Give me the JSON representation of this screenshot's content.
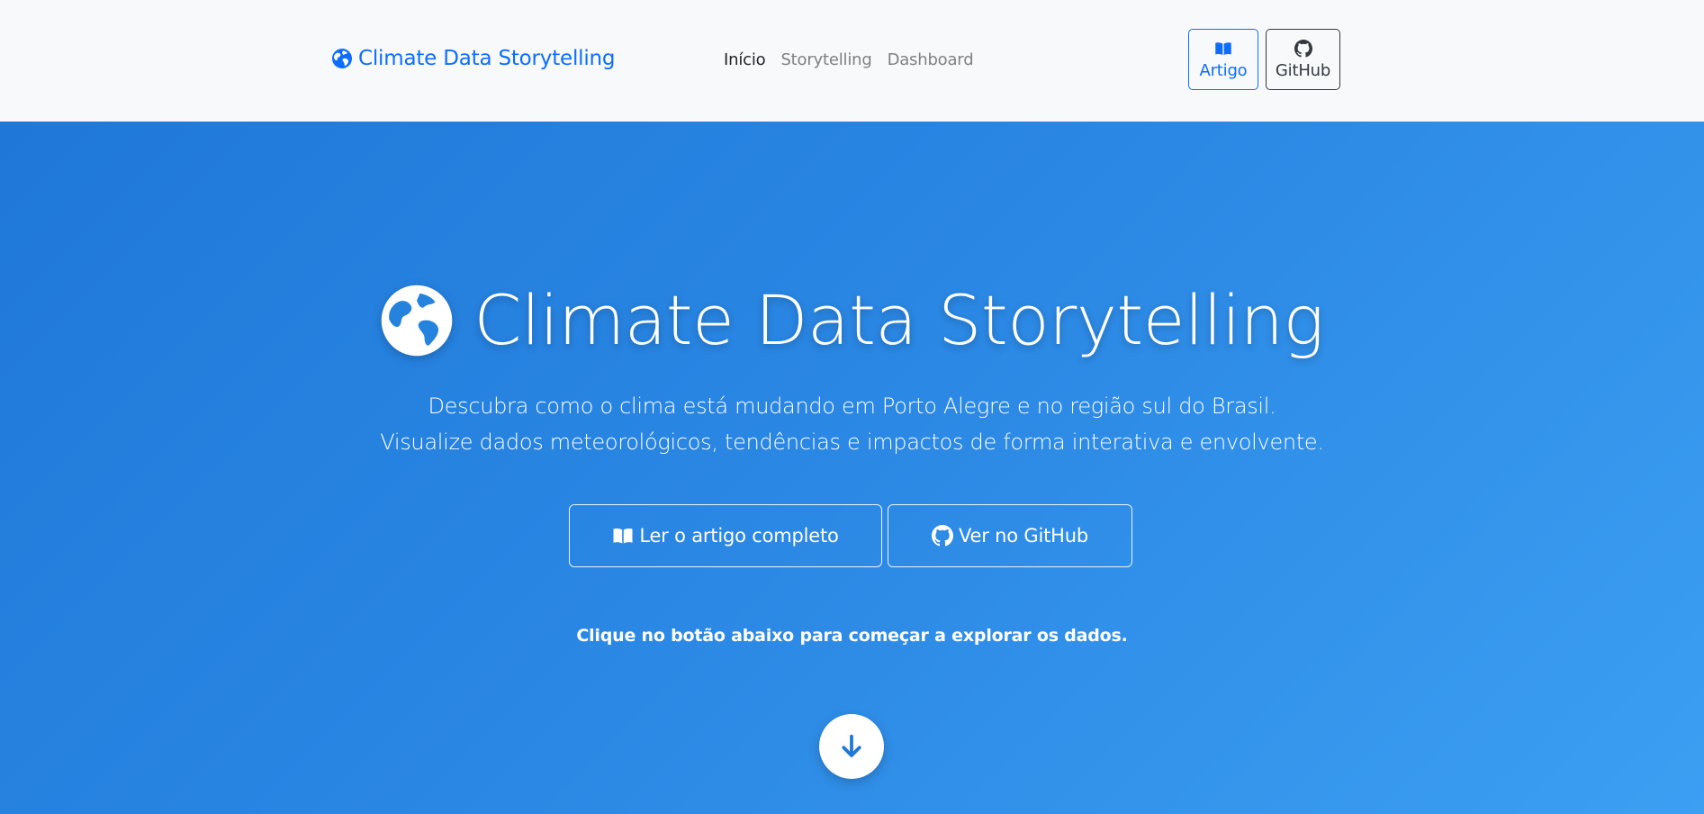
{
  "navbar": {
    "brand": "Climate Data Storytelling",
    "links": [
      {
        "label": "Início",
        "active": true
      },
      {
        "label": "Storytelling",
        "active": false
      },
      {
        "label": "Dashboard",
        "active": false
      }
    ],
    "artigo_label": "Artigo",
    "github_label": "GitHub"
  },
  "hero": {
    "title": "Climate Data Storytelling",
    "subtitle_line1": "Descubra como o clima está mudando em Porto Alegre e no região sul do Brasil.",
    "subtitle_line2": "Visualize dados meteorológicos, tendências e impactos de forma interativa e envolvente.",
    "read_button": "Ler o artigo completo",
    "repo_button": "Ver no GitHub",
    "cta": "Clique no botão abaixo para começar a explorar os dados."
  },
  "colors": {
    "brand": "#0d6efd",
    "hero_start": "#1f78d8",
    "hero_end": "#3c9ff2",
    "scroll_arrow": "#1f78d8"
  },
  "icons": {
    "brand": "globe-icon",
    "artigo": "book-open-icon",
    "github": "github-icon",
    "scroll": "arrow-down-icon"
  }
}
